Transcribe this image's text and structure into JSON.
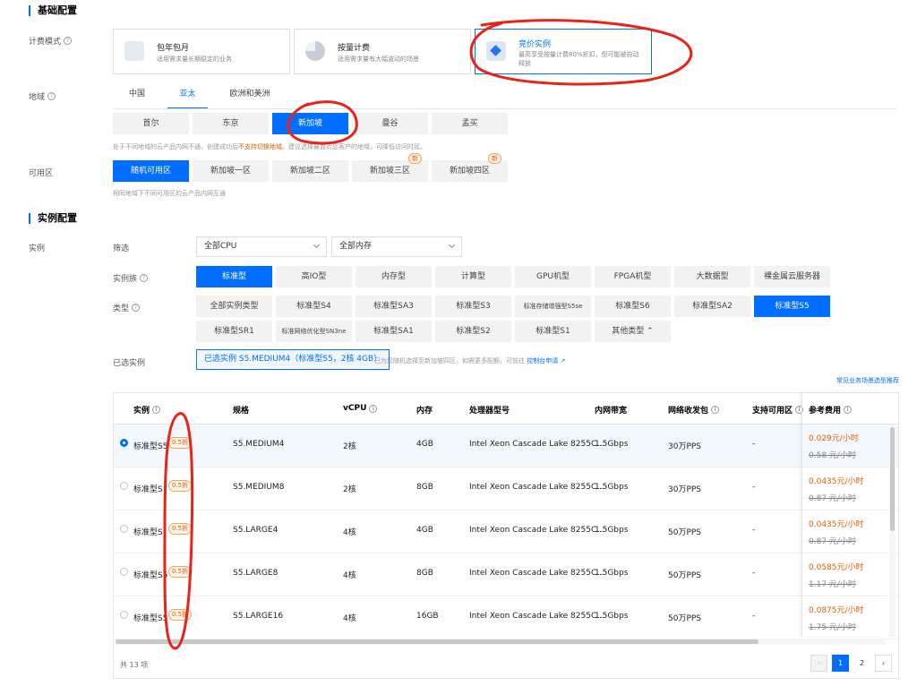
{
  "basic": {
    "title": "基础配置",
    "billing_label": "计费模式",
    "billing": [
      {
        "title": "包年包月",
        "desc": "适用需求量长期稳定的业务",
        "icon": "calendar-icon"
      },
      {
        "title": "按量计费",
        "desc": "适用需求量有大幅波动的场景",
        "icon": "pie-chart-icon"
      },
      {
        "title": "竞价实例",
        "desc": "最高享受按量计费80%折扣，但可能被自动\n释放",
        "icon": "price-tag-icon"
      }
    ],
    "region_label": "地域",
    "region_tabs": [
      "中国",
      "亚太",
      "欧洲和美洲"
    ],
    "cities": [
      "首尔",
      "东京",
      "新加坡",
      "曼谷",
      "孟买"
    ],
    "region_tip_pre": "处于不同地域的云产品内网不通，创建成功后",
    "region_tip_warn": "不支持切换地域",
    "region_tip_post": "。建议选择最靠近您客户的地域，可降低访问时延。",
    "zone_label": "可用区",
    "zones": [
      "随机可用区",
      "新加坡一区",
      "新加坡二区",
      "新加坡三区",
      "新加坡四区"
    ],
    "new_badge": "新",
    "zone_tip": "相同地域下不同可用区的云产品内网互通"
  },
  "instance": {
    "title": "实例配置",
    "label": "实例",
    "filter_label": "筛选",
    "cpu_select": "全部CPU",
    "mem_select": "全部内存",
    "family_label": "实例族",
    "families": [
      "标准型",
      "高IO型",
      "内存型",
      "计算型",
      "GPU机型",
      "FPGA机型",
      "大数据型",
      "裸金属云服务器"
    ],
    "type_label": "类型",
    "types_row1": [
      "全部实例类型",
      "标准型S4",
      "标准型SA3",
      "标准型S3",
      "标准存储增强型S5se",
      "标准型S6",
      "标准型SA2",
      "标准型S5"
    ],
    "types_row2": [
      "标准型SR1",
      "标准网络优化型SN3ne",
      "标准型SA1",
      "标准型S2",
      "标准型S1",
      "其他类型 ⌃"
    ],
    "chosen_label": "已选实例",
    "chosen_value": "已选实例 S5.MEDIUM4（标准型S5，2核 4GB）",
    "chosen_tip": "已为您随机选择至新加坡四区，如需更多配额，可前往",
    "chosen_link": "控制台申请",
    "scenario_link": "常见业务场景选型推荐"
  },
  "table": {
    "headers": [
      "实例",
      "规格",
      "vCPU",
      "内存",
      "处理器型号",
      "内网带宽",
      "网络收发包",
      "支持可用区",
      "参考费用"
    ],
    "rows": [
      {
        "name": "标准型S5",
        "discount": "0.5折",
        "spec": "S5.MEDIUM4",
        "vcpu": "2核",
        "mem": "4GB",
        "cpu": "Intel Xeon Cascade Lake 8255C...",
        "bw": "1.5Gbps",
        "pps": "30万PPS",
        "zone": "-",
        "price": "0.029元/小时",
        "orig": "0.58 元/小时"
      },
      {
        "name": "标准型S",
        "discount": "0.5折",
        "spec": "S5.MEDIUM8",
        "vcpu": "2核",
        "mem": "8GB",
        "cpu": "Intel Xeon Cascade Lake 8255C...",
        "bw": "1.5Gbps",
        "pps": "30万PPS",
        "zone": "-",
        "price": "0.0435元/小时",
        "orig": "0.87 元/小时"
      },
      {
        "name": "标准型S",
        "discount": "0.5折",
        "spec": "S5.LARGE4",
        "vcpu": "4核",
        "mem": "4GB",
        "cpu": "Intel Xeon Cascade Lake 8255C...",
        "bw": "1.5Gbps",
        "pps": "50万PPS",
        "zone": "-",
        "price": "0.0435元/小时",
        "orig": "0.87 元/小时"
      },
      {
        "name": "标准型S5",
        "discount": "0.5折",
        "spec": "S5.LARGE8",
        "vcpu": "4核",
        "mem": "8GB",
        "cpu": "Intel Xeon Cascade Lake 8255C...",
        "bw": "1.5Gbps",
        "pps": "50万PPS",
        "zone": "-",
        "price": "0.0585元/小时",
        "orig": "1.17 元/小时"
      },
      {
        "name": "标准型S5",
        "discount": "0.5折",
        "spec": "S5.LARGE16",
        "vcpu": "4核",
        "mem": "16GB",
        "cpu": "Intel Xeon Cascade Lake 8255C...",
        "bw": "1.5Gbps",
        "pps": "50万PPS",
        "zone": "-",
        "price": "0.0875元/小时",
        "orig": "1.75 元/小时"
      }
    ],
    "total": "共 13 项",
    "pages": [
      "1",
      "2"
    ],
    "prev": "‹",
    "next": "›"
  },
  "colors": {
    "accent": "#006eff",
    "discount": "#e35f05",
    "annotation": "#e8231a"
  }
}
